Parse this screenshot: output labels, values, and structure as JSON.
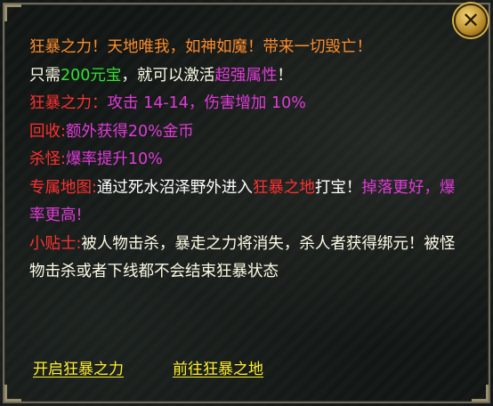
{
  "dialog": {
    "title_line": "狂暴之力！天地唯我，如神如魔！带来一切毁亡！",
    "activate_line": {
      "prefix": "只需",
      "amount": "200元宝",
      "middle": "，就可以激活",
      "highlight": "超强属性",
      "suffix": "！"
    },
    "attr_line": {
      "label": "狂暴之力：",
      "value": "攻击 14-14，伤害增加 10%"
    },
    "recycle_line": {
      "label": "回收:",
      "value": "额外获得20%金币"
    },
    "kill_line": {
      "label": "杀怪:",
      "value": "爆率提升10%"
    },
    "map_line": {
      "label": "专属地图:",
      "text1": "通过死水沼泽野外进入",
      "place": "狂暴之地",
      "text2": "打宝！",
      "bonus": "掉落更好，爆率更高!"
    },
    "tip_line": {
      "label": "小贴士:",
      "text": "被人物击杀，暴走之力将消失，杀人者获得绑元！被怪物击杀或者下线都不会结束狂暴状态"
    }
  },
  "actions": {
    "activate_link": "开启狂暴之力",
    "goto_link": "前往狂暴之地"
  },
  "colors": {
    "orange": "#ff8c2a",
    "red": "#ff3030",
    "green": "#33e233",
    "magenta": "#e03bd8",
    "link_yellow": "#ffef2a"
  },
  "icons": {
    "close": "close-icon"
  }
}
